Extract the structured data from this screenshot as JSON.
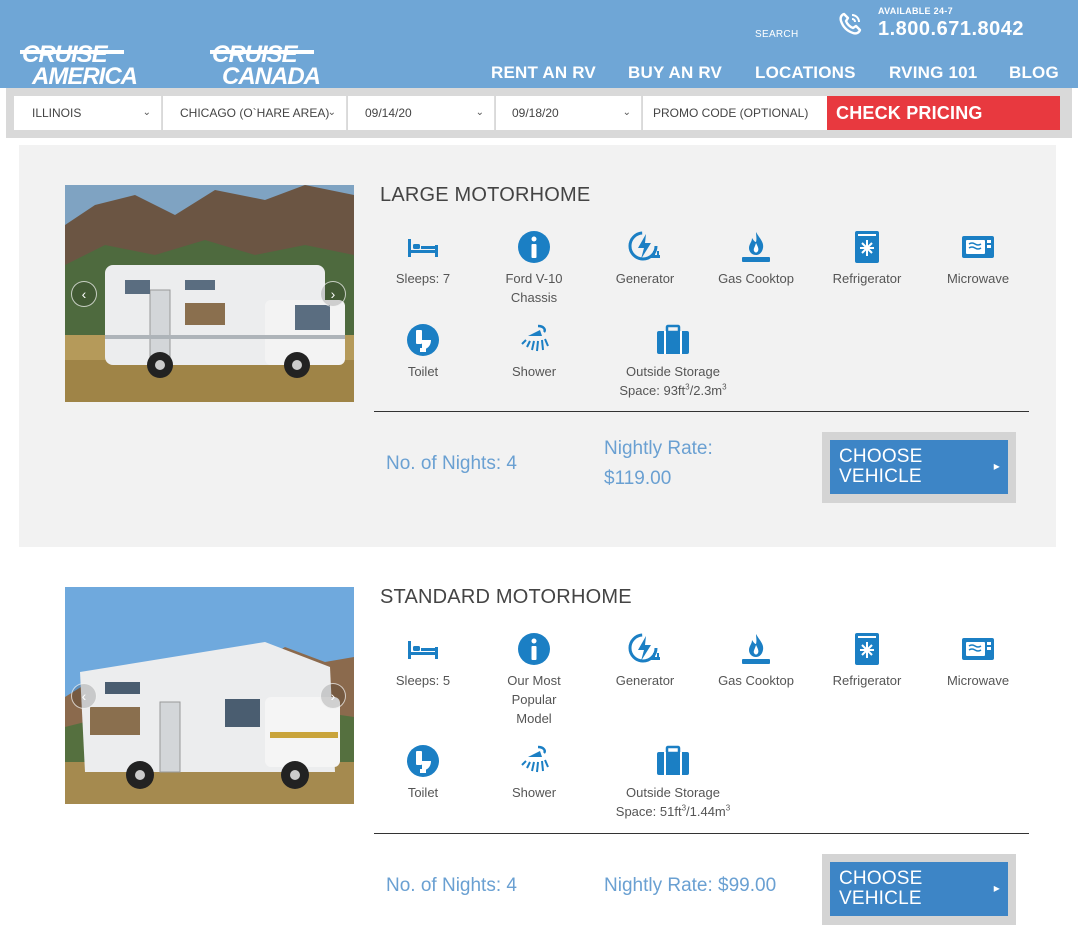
{
  "header": {
    "logos": {
      "america": {
        "line1": "CRUISE",
        "line2": "AMERICA"
      },
      "canada": {
        "line1": "CRUISE",
        "line2": "CANADA"
      }
    },
    "search_label": "SEARCH",
    "availability": "AVAILABLE 24-7",
    "phone": "1.800.671.8042",
    "nav": [
      "RENT AN RV",
      "BUY AN RV",
      "LOCATIONS",
      "RVING 101",
      "BLOG"
    ]
  },
  "search_bar": {
    "state": "ILLINOIS",
    "city": "CHICAGO (O`HARE AREA)",
    "pickup_date": "09/14/20",
    "return_date": "09/18/20",
    "promo_placeholder": "PROMO CODE (OPTIONAL)",
    "check_label": "CHECK PRICING"
  },
  "vehicles": [
    {
      "title": "LARGE MOTORHOME",
      "features": {
        "sleeps": "Sleeps: 7",
        "chassis": [
          "Ford V-10",
          "Chassis"
        ],
        "generator": "Generator",
        "cooktop": "Gas Cooktop",
        "fridge": "Refrigerator",
        "microwave": "Microwave",
        "toilet": "Toilet",
        "shower": "Shower",
        "storage_line1": "Outside Storage",
        "storage_prefix": "Space: 93ft",
        "storage_sup1": "3",
        "storage_mid": "/2.3m",
        "storage_sup2": "3"
      },
      "nights": "No. of Nights: 4",
      "rate_label": "Nightly Rate:",
      "rate_value": "$119.00",
      "choose_line1": "CHOOSE",
      "choose_line2": "VEHICLE"
    },
    {
      "title": "STANDARD MOTORHOME",
      "features": {
        "sleeps": "Sleeps: 5",
        "chassis": [
          "Our Most",
          "Popular",
          "Model"
        ],
        "generator": "Generator",
        "cooktop": "Gas Cooktop",
        "fridge": "Refrigerator",
        "microwave": "Microwave",
        "toilet": "Toilet",
        "shower": "Shower",
        "storage_line1": "Outside Storage",
        "storage_prefix": "Space: 51ft",
        "storage_sup1": "3",
        "storage_mid": "/1.44m",
        "storage_sup2": "3"
      },
      "nights": "No. of Nights: 4",
      "rate_label": "Nightly Rate: $99.00",
      "choose_line1": "CHOOSE",
      "choose_line2": "VEHICLE"
    }
  ],
  "icons": {
    "bed": "bed-icon",
    "info": "info-icon",
    "generator": "generator-icon",
    "flame": "flame-icon",
    "fridge": "refrigerator-icon",
    "microwave": "microwave-icon",
    "toilet": "toilet-icon",
    "shower": "shower-icon",
    "storage": "storage-icon"
  },
  "colors": {
    "header_bg": "#6fa6d6",
    "cta_red": "#e8393f",
    "button_blue": "#3d85c6",
    "icon_blue": "#1b7fc4",
    "price_blue": "#6aa0d2"
  }
}
